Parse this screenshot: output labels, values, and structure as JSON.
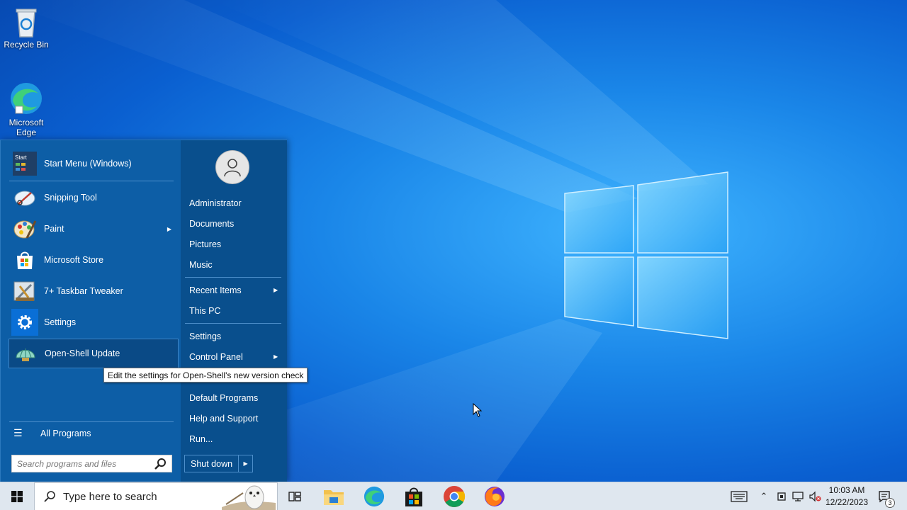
{
  "desktop": {
    "icons": [
      {
        "label": "Recycle Bin",
        "icon": "recycle-bin-icon"
      },
      {
        "label": "Microsoft Edge",
        "icon": "edge-icon"
      }
    ]
  },
  "start_menu": {
    "pinned": [
      {
        "label": "Start Menu (Windows)",
        "icon": "start-menu-icon",
        "icon_text": "Start"
      },
      {
        "label": "Snipping Tool",
        "icon": "snipping-tool-icon"
      },
      {
        "label": "Paint",
        "icon": "paint-icon",
        "has_submenu": true
      },
      {
        "label": "Microsoft Store",
        "icon": "store-icon"
      },
      {
        "label": "7+ Taskbar Tweaker",
        "icon": "taskbar-tweaker-icon"
      },
      {
        "label": "Settings",
        "icon": "gear-icon"
      },
      {
        "label": "Open-Shell Update",
        "icon": "shell-icon",
        "highlighted": true
      }
    ],
    "all_programs": "All Programs",
    "search_placeholder": "Search programs and files",
    "right": {
      "user": "Administrator",
      "items": [
        {
          "label": "Documents"
        },
        {
          "label": "Pictures"
        },
        {
          "label": "Music"
        },
        {
          "label": "Recent Items",
          "has_submenu": true
        },
        {
          "label": "This PC"
        },
        {
          "label": "Settings"
        },
        {
          "label": "Control Panel",
          "has_submenu": true
        },
        {
          "label": "Default Programs"
        },
        {
          "label": "Help and Support"
        },
        {
          "label": "Run..."
        }
      ]
    },
    "shutdown_label": "Shut down"
  },
  "tooltip": "Edit the settings for Open-Shell's new version check",
  "taskbar": {
    "search_text": "Type here to search",
    "clock_time": "10:03 AM",
    "clock_date": "12/22/2023",
    "notification_count": "3",
    "apps": [
      "task-view-icon",
      "file-explorer-icon",
      "edge-icon",
      "store-icon",
      "chrome-icon",
      "firefox-icon"
    ]
  },
  "colors": {
    "menu_left": "#0d5ea6",
    "menu_right": "#094f8d",
    "highlight": "#0a4a86",
    "taskbar": "#dfe7ef"
  }
}
